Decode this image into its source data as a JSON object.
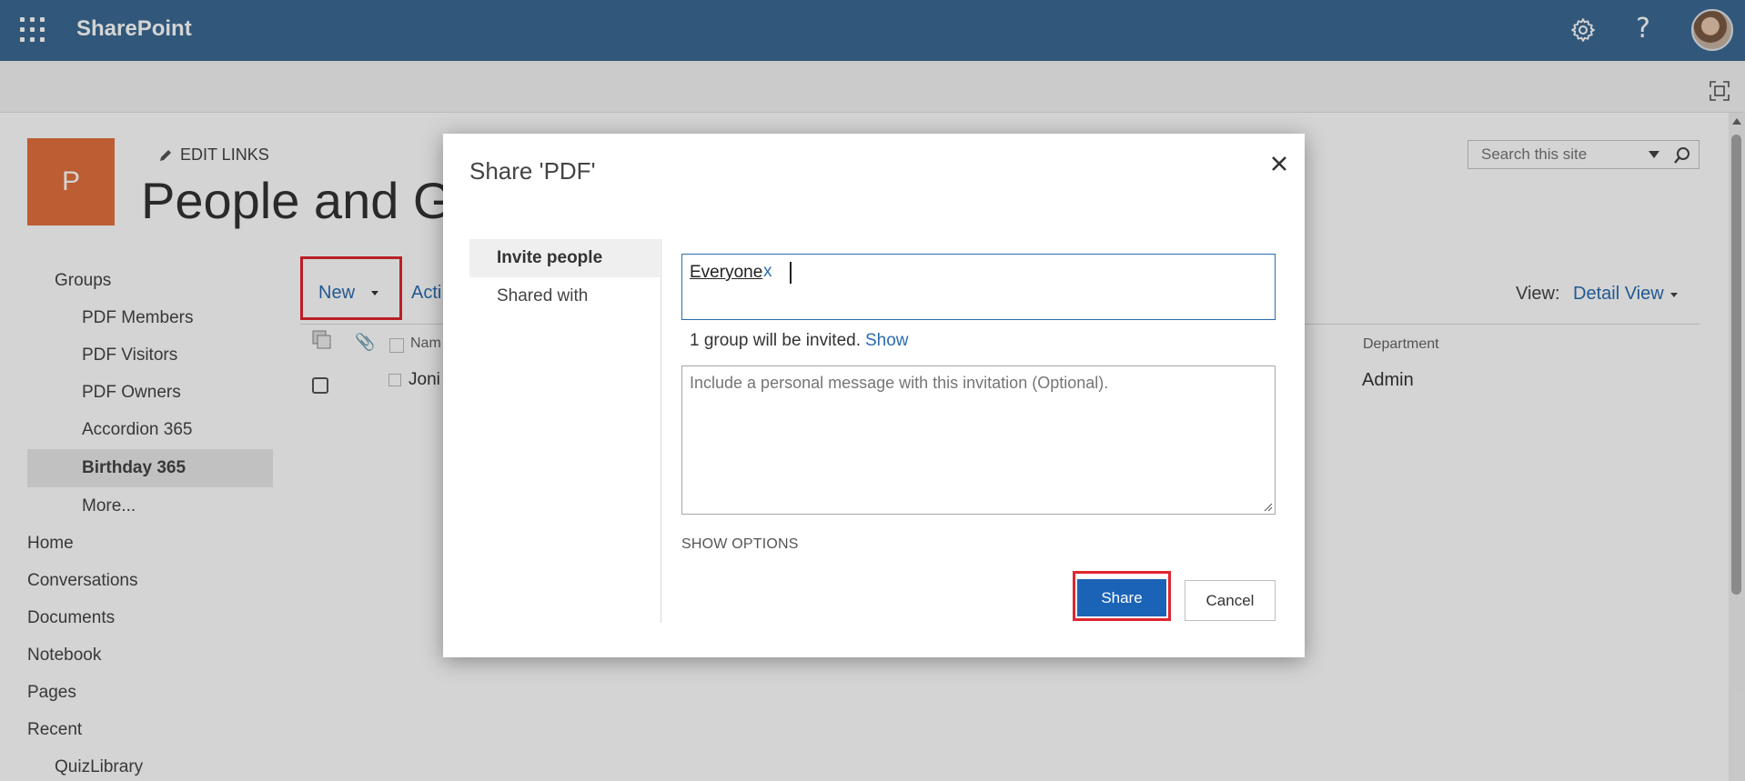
{
  "suite_bar": {
    "brand": "SharePoint",
    "icons": [
      "waffle-icon",
      "gear-icon",
      "help-icon",
      "avatar"
    ]
  },
  "site": {
    "logo_letter": "P",
    "edit_links": "EDIT LINKS",
    "page_title": "People and Gro",
    "search_placeholder": "Search this site"
  },
  "left_nav": {
    "groups_heading": "Groups",
    "group_items": [
      "PDF Members",
      "PDF Visitors",
      "PDF Owners",
      "Accordion 365",
      "Birthday 365",
      "More..."
    ],
    "selected_item": "Birthday 365",
    "top_items": [
      "Home",
      "Conversations",
      "Documents",
      "Notebook",
      "Pages",
      "Recent"
    ],
    "recent_items": [
      "QuizLibrary"
    ]
  },
  "list": {
    "new_label": "New",
    "actions_label": "Acti",
    "view_label": "View:",
    "view_value": "Detail View",
    "columns": {
      "name": "Nam",
      "department": "Department"
    },
    "rows": [
      {
        "name": "Joni",
        "department": "Admin"
      }
    ]
  },
  "dialog": {
    "title": "Share 'PDF'",
    "tabs": [
      "Invite people",
      "Shared with"
    ],
    "active_tab": "Invite people",
    "invitee_chip": "Everyone",
    "chip_remove": "x",
    "invited_message": "1 group will be invited.",
    "show_link": "Show",
    "message_placeholder": "Include a personal message with this invitation (Optional).",
    "show_options": "SHOW OPTIONS",
    "share_label": "Share",
    "cancel_label": "Cancel"
  },
  "colors": {
    "suite_bar": "#3c6a94",
    "accent": "#1b63b6",
    "site_logo": "#e2703e",
    "highlight": "#e0262e"
  }
}
